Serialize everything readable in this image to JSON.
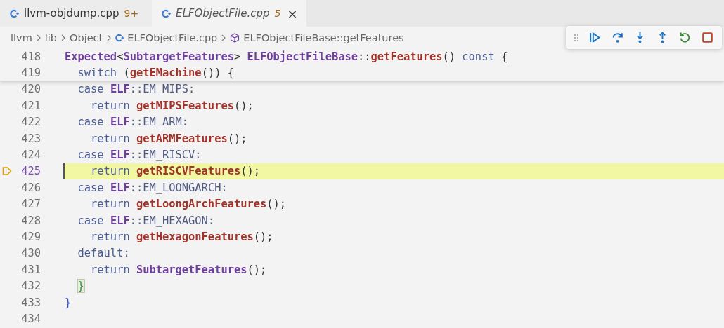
{
  "tabs": [
    {
      "label": "llvm-objdump.cpp",
      "badge": "9+",
      "selected": false
    },
    {
      "label": "ELFObjectFile.cpp",
      "badge": "5",
      "close": "×",
      "selected": true
    }
  ],
  "breadcrumbs": [
    {
      "kind": "folder",
      "label": "llvm"
    },
    {
      "kind": "folder",
      "label": "lib"
    },
    {
      "kind": "folder",
      "label": "Object"
    },
    {
      "kind": "file",
      "label": "ELFObjectFile.cpp"
    },
    {
      "kind": "symbol",
      "label": "ELFObjectFileBase::getFeatures"
    }
  ],
  "debug_toolbar": [
    {
      "kind": "continue"
    },
    {
      "kind": "step-over"
    },
    {
      "kind": "step-into"
    },
    {
      "kind": "step-out"
    },
    {
      "kind": "restart"
    },
    {
      "kind": "stop"
    }
  ],
  "sticky_lines": [
    {
      "number": "418",
      "tokens": [
        {
          "kind": "type",
          "text": "Expected"
        },
        {
          "kind": "punct",
          "text": "<"
        },
        {
          "kind": "type",
          "text": "SubtargetFeatures"
        },
        {
          "kind": "punct",
          "text": "> "
        },
        {
          "kind": "type",
          "text": "ELFObjectFileBase"
        },
        {
          "kind": "punct",
          "text": "::"
        },
        {
          "kind": "fn",
          "text": "getFeatures"
        },
        {
          "kind": "punct",
          "text": "() "
        },
        {
          "kind": "kw",
          "text": "const"
        },
        {
          "kind": "punct",
          "text": " {"
        }
      ]
    },
    {
      "number": "419",
      "tokens": [
        {
          "kind": "kw",
          "text": "  switch"
        },
        {
          "kind": "punct",
          "text": " ("
        },
        {
          "kind": "fn",
          "text": "getEMachine"
        },
        {
          "kind": "punct",
          "text": "()) {"
        }
      ]
    }
  ],
  "lines": [
    {
      "number": "420",
      "current": false,
      "tokens": [
        {
          "kind": "kw",
          "text": "  case "
        },
        {
          "kind": "ns",
          "text": "ELF"
        },
        {
          "kind": "plain",
          "text": "::EM_MIPS:"
        }
      ]
    },
    {
      "number": "421",
      "current": false,
      "tokens": [
        {
          "kind": "kw",
          "text": "    return "
        },
        {
          "kind": "fn",
          "text": "getMIPSFeatures"
        },
        {
          "kind": "punct",
          "text": "();"
        }
      ]
    },
    {
      "number": "422",
      "current": false,
      "tokens": [
        {
          "kind": "kw",
          "text": "  case "
        },
        {
          "kind": "ns",
          "text": "ELF"
        },
        {
          "kind": "plain",
          "text": "::EM_ARM:"
        }
      ]
    },
    {
      "number": "423",
      "current": false,
      "tokens": [
        {
          "kind": "kw",
          "text": "    return "
        },
        {
          "kind": "fn",
          "text": "getARMFeatures"
        },
        {
          "kind": "punct",
          "text": "();"
        }
      ]
    },
    {
      "number": "424",
      "current": false,
      "tokens": [
        {
          "kind": "kw",
          "text": "  case "
        },
        {
          "kind": "ns",
          "text": "ELF"
        },
        {
          "kind": "plain",
          "text": "::EM_RISCV:"
        }
      ]
    },
    {
      "number": "425",
      "current": true,
      "tokens": [
        {
          "kind": "kw",
          "text": "    return "
        },
        {
          "kind": "fn",
          "text": "getRISCVFeatures"
        },
        {
          "kind": "punct",
          "text": "();"
        }
      ]
    },
    {
      "number": "426",
      "current": false,
      "tokens": [
        {
          "kind": "kw",
          "text": "  case "
        },
        {
          "kind": "ns",
          "text": "ELF"
        },
        {
          "kind": "plain",
          "text": "::EM_LOONGARCH:"
        }
      ]
    },
    {
      "number": "427",
      "current": false,
      "tokens": [
        {
          "kind": "kw",
          "text": "    return "
        },
        {
          "kind": "fn",
          "text": "getLoongArchFeatures"
        },
        {
          "kind": "punct",
          "text": "();"
        }
      ]
    },
    {
      "number": "428",
      "current": false,
      "tokens": [
        {
          "kind": "kw",
          "text": "  case "
        },
        {
          "kind": "ns",
          "text": "ELF"
        },
        {
          "kind": "plain",
          "text": "::EM_HEXAGON:"
        }
      ]
    },
    {
      "number": "429",
      "current": false,
      "tokens": [
        {
          "kind": "kw",
          "text": "    return "
        },
        {
          "kind": "fn",
          "text": "getHexagonFeatures"
        },
        {
          "kind": "punct",
          "text": "();"
        }
      ]
    },
    {
      "number": "430",
      "current": false,
      "tokens": [
        {
          "kind": "kw",
          "text": "  default:"
        }
      ]
    },
    {
      "number": "431",
      "current": false,
      "tokens": [
        {
          "kind": "kw",
          "text": "    return "
        },
        {
          "kind": "type",
          "text": "SubtargetFeatures"
        },
        {
          "kind": "punct",
          "text": "();"
        }
      ]
    },
    {
      "number": "432",
      "current": false,
      "tokens": [
        {
          "kind": "match",
          "text": "}"
        }
      ]
    },
    {
      "number": "433",
      "current": false,
      "tokens": [
        {
          "kind": "brace",
          "text": "}"
        }
      ]
    },
    {
      "number": "434",
      "current": false
    }
  ]
}
